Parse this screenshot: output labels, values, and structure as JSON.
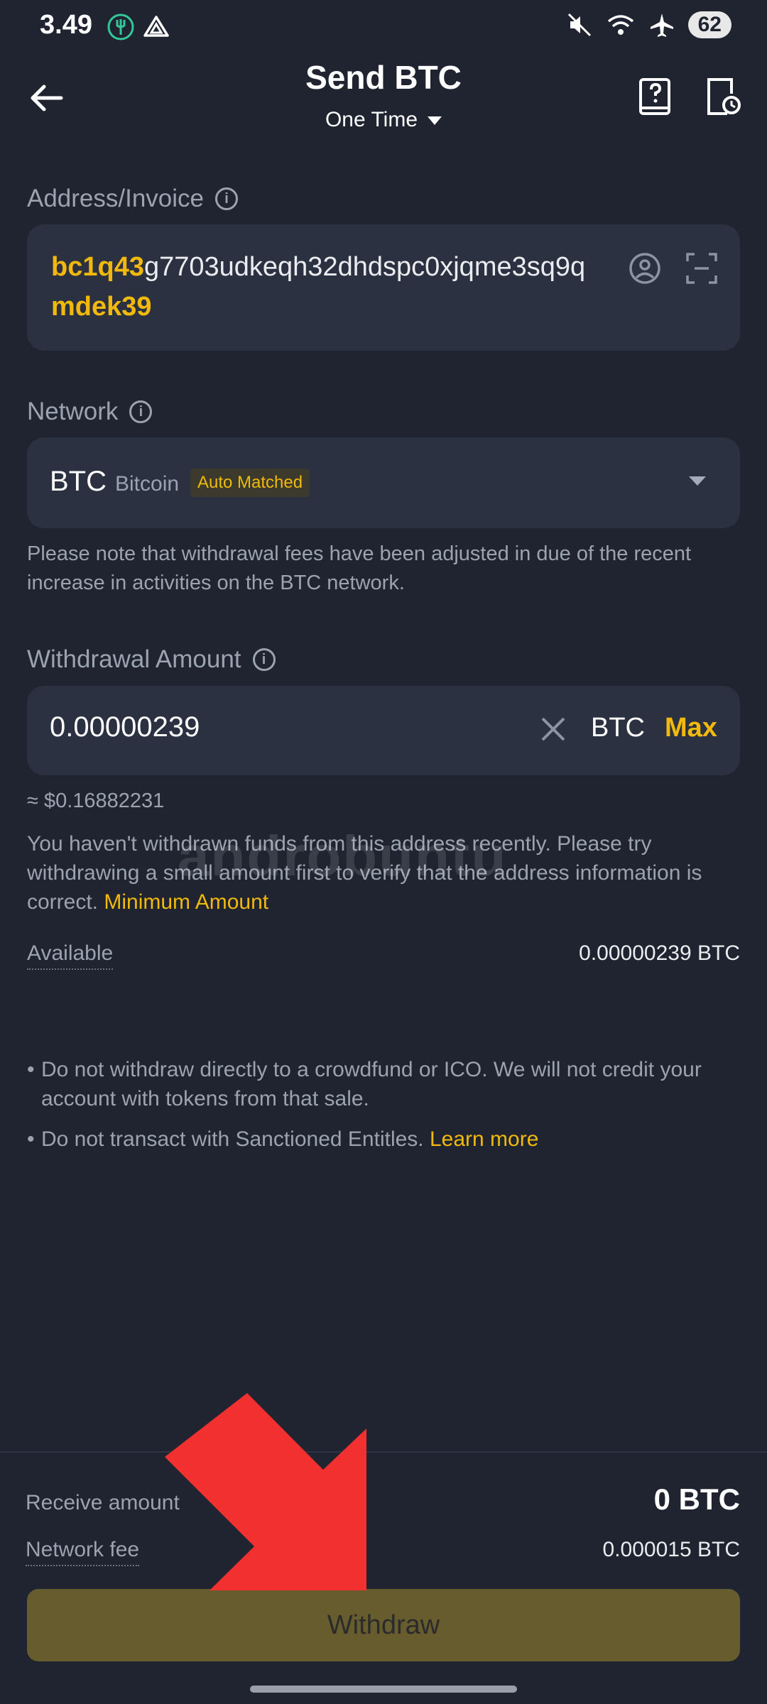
{
  "status_bar": {
    "time": "3.49",
    "battery": "62"
  },
  "header": {
    "title": "Send BTC",
    "subtitle": "One Time"
  },
  "address": {
    "label": "Address/Invoice",
    "prefix": "bc1q43",
    "middle": "g7703udkeqh32dhdspc0xjqme3sq9q",
    "suffix": "mdek39"
  },
  "network": {
    "label": "Network",
    "symbol": "BTC",
    "name": "Bitcoin",
    "badge": "Auto Matched",
    "note": "Please note that withdrawal fees have been adjusted in due of the recent increase in activities on the BTC network."
  },
  "withdrawal": {
    "label": "Withdrawal Amount",
    "value": "0.00000239",
    "unit": "BTC",
    "max_label": "Max",
    "approx": "≈ $0.16882231",
    "warning": "You haven't withdrawn funds from this address recently. Please try withdrawing a small amount first to verify that the address information is correct.",
    "warning_link": "Minimum Amount",
    "available_label": "Available",
    "available_value": "0.00000239 BTC"
  },
  "notices": {
    "item1": "Do not withdraw directly to a crowdfund or ICO. We will not credit your account with tokens from that sale.",
    "item2": "Do not transact with Sanctioned Entitles.",
    "item2_link": "Learn more"
  },
  "summary": {
    "receive_label": "Receive amount",
    "receive_value": "0 BTC",
    "fee_label": "Network fee",
    "fee_value": "0.000015 BTC",
    "withdraw_button": "Withdraw"
  },
  "watermark": "androbuntu",
  "colors": {
    "accent": "#f0b90b",
    "background": "#1f2430",
    "card": "#2b3140",
    "arrow": "#f2302f"
  }
}
